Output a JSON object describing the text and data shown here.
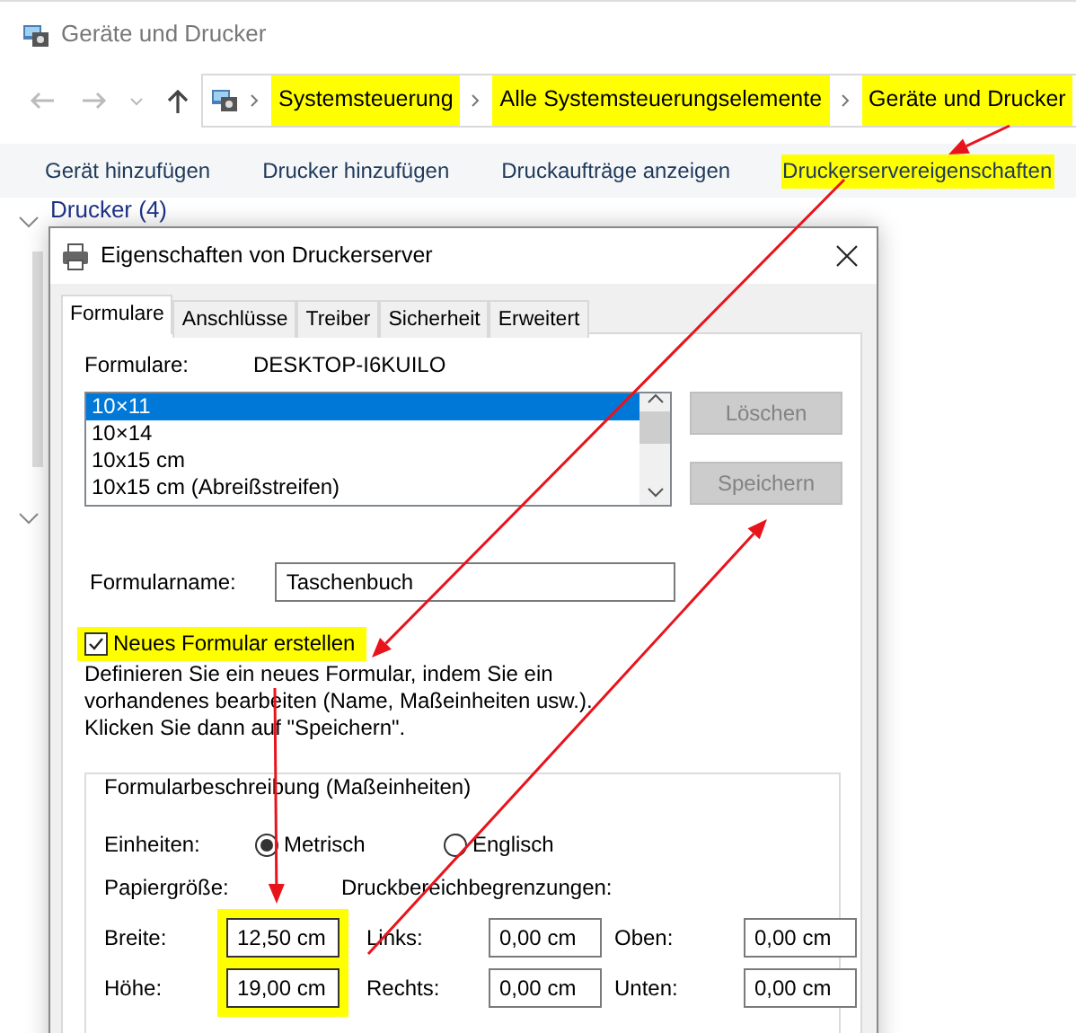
{
  "explorer": {
    "title": "Geräte und Drucker",
    "breadcrumb": [
      {
        "label": "Systemsteuerung",
        "highlight": true
      },
      {
        "label": "Alle Systemsteuerungselemente",
        "highlight": true
      },
      {
        "label": "Geräte und Drucker",
        "highlight": true
      }
    ],
    "toolbar": [
      {
        "label": "Gerät hinzufügen",
        "highlight": false
      },
      {
        "label": "Drucker hinzufügen",
        "highlight": false
      },
      {
        "label": "Druckaufträge anzeigen",
        "highlight": false
      },
      {
        "label": "Druckerservereigenschaften",
        "highlight": true
      }
    ],
    "group_header": "Drucker (4)"
  },
  "dialog": {
    "title": "Eigenschaften von Druckerserver",
    "tabs": [
      {
        "label": "Formulare",
        "selected": true
      },
      {
        "label": "Anschlüsse",
        "selected": false
      },
      {
        "label": "Treiber",
        "selected": false
      },
      {
        "label": "Sicherheit",
        "selected": false
      },
      {
        "label": "Erweitert",
        "selected": false
      }
    ],
    "forms_label": "Formulare:",
    "server_name": "DESKTOP-I6KUILO",
    "forms": [
      {
        "label": "10×11",
        "selected": true
      },
      {
        "label": "10×14",
        "selected": false
      },
      {
        "label": "10x15 cm",
        "selected": false
      },
      {
        "label": "10x15 cm (Abreißstreifen)",
        "selected": false
      }
    ],
    "buttons": [
      {
        "label": "Löschen",
        "disabled": true
      },
      {
        "label": "Speichern",
        "disabled": true
      }
    ],
    "form_name": {
      "label": "Formularname:",
      "value": "Taschenbuch"
    },
    "new_form": {
      "label": "Neues Formular erstellen",
      "checked": true,
      "highlight": true
    },
    "description": [
      "Definieren Sie ein neues Formular, indem Sie ein",
      "vorhandenes bearbeiten (Name, Maßeinheiten usw.).",
      "Klicken Sie dann auf \"Speichern\"."
    ],
    "group": {
      "title": "Formularbeschreibung (Maßeinheiten)",
      "units_label": "Einheiten:",
      "units": [
        {
          "label": "Metrisch",
          "selected": true
        },
        {
          "label": "Englisch",
          "selected": false
        }
      ],
      "paper_label": "Papiergröße:",
      "margins_label": "Druckbereichbegrenzungen:",
      "rows": [
        [
          {
            "label": "Breite:",
            "value": "12,50 cm",
            "highlight": true
          },
          {
            "label": "Links:",
            "value": "0,00 cm",
            "highlight": false
          },
          {
            "label": "Oben:",
            "value": "0,00 cm",
            "highlight": false
          }
        ],
        [
          {
            "label": "Höhe:",
            "value": "19,00 cm",
            "highlight": true
          },
          {
            "label": "Rechts:",
            "value": "0,00 cm",
            "highlight": false
          },
          {
            "label": "Unten:",
            "value": "0,00 cm",
            "highlight": false
          }
        ]
      ]
    }
  }
}
